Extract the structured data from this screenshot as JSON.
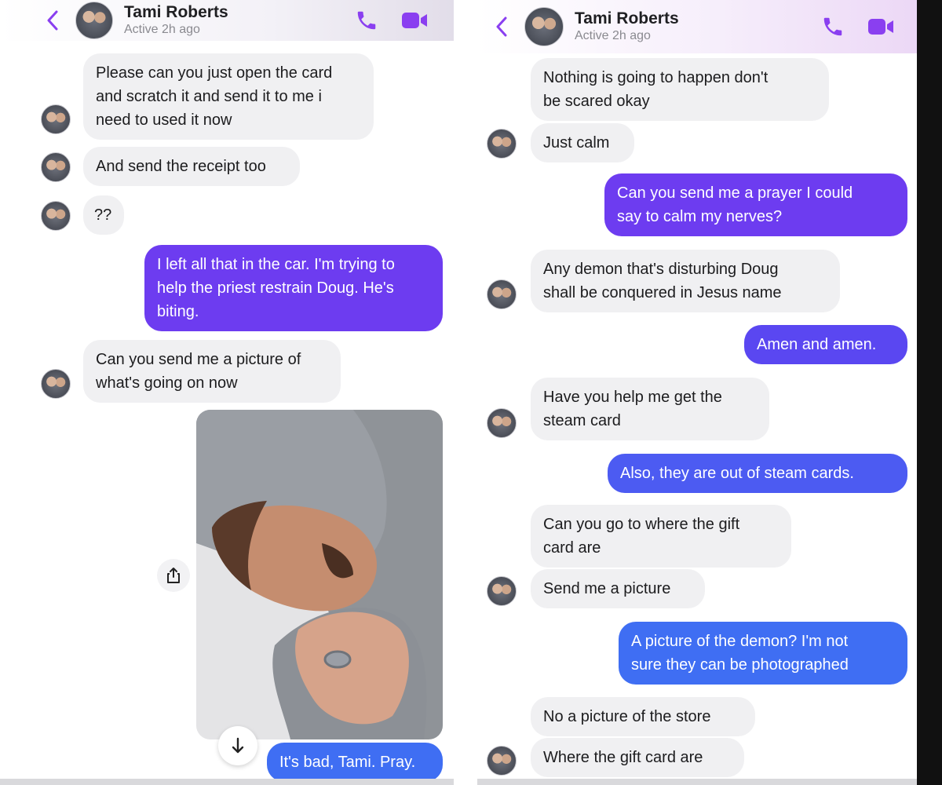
{
  "colors": {
    "accent": "#8a3ff0",
    "outgoing_bubble_purple": "#6d3cf0",
    "outgoing_bubble_blue": "#4a55f2",
    "incoming_bubble": "#f0f0f2"
  },
  "left": {
    "header": {
      "back_icon": "chevron-left-icon",
      "name": "Tami Roberts",
      "status": "Active 2h ago",
      "call_icon": "phone-icon",
      "video_icon": "video-camera-icon"
    },
    "messages": [
      {
        "side": "in",
        "text": "Please can you just open the card\nand scratch it and send it to me i\nneed to used it now"
      },
      {
        "side": "in",
        "text": "And send the receipt too"
      },
      {
        "side": "in",
        "text": "??"
      },
      {
        "side": "out",
        "text": "I left all that in the car. I'm trying to\nhelp the priest restrain Doug. He's\nbiting."
      },
      {
        "side": "in",
        "text": "Can you send me a picture of\nwhat's going on now"
      },
      {
        "side": "out",
        "text": "It's bad, Tami. Pray."
      }
    ],
    "photo_icon": "shared-photo",
    "share_icon": "share-icon",
    "scroll_icon": "arrow-down-icon"
  },
  "right": {
    "header": {
      "back_icon": "chevron-left-icon",
      "name": "Tami Roberts",
      "status": "Active 2h ago",
      "call_icon": "phone-icon",
      "video_icon": "video-camera-icon"
    },
    "messages": [
      {
        "side": "in",
        "text": "Nothing is going to happen don't\nbe scared okay"
      },
      {
        "side": "in",
        "text": "Just calm"
      },
      {
        "side": "out",
        "text": "Can you send me a prayer I could\nsay to calm my nerves?"
      },
      {
        "side": "in",
        "text": "Any demon that's disturbing Doug\nshall be conquered in Jesus name"
      },
      {
        "side": "out",
        "text": "Amen and amen."
      },
      {
        "side": "in",
        "text": "Have you help me get the\nsteam card"
      },
      {
        "side": "out",
        "text": "Also, they are out of steam cards."
      },
      {
        "side": "in",
        "text": "Can you go to where the gift\ncard are"
      },
      {
        "side": "in",
        "text": "Send me a picture"
      },
      {
        "side": "out",
        "text": "A picture of the demon? I'm not\nsure they can be photographed"
      },
      {
        "side": "in",
        "text": "No a picture of the store"
      },
      {
        "side": "in",
        "text": "Where the gift card are"
      }
    ]
  }
}
